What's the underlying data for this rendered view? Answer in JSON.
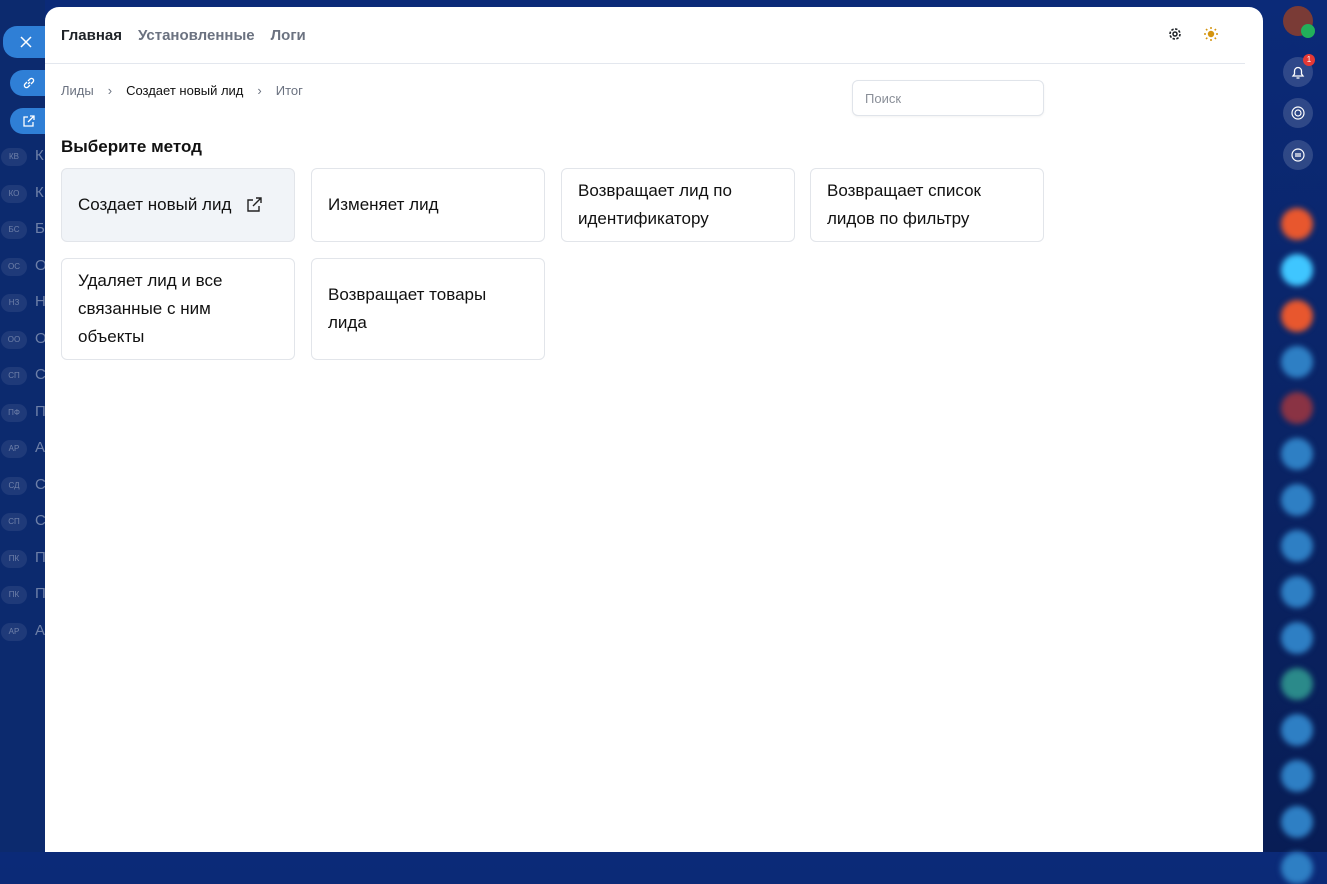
{
  "left_sidebar": {
    "abbreviations": [
      "КВ",
      "КО",
      "БС",
      "ОС",
      "НЗ",
      "ОО",
      "СП",
      "ПФ",
      "АР",
      "СД",
      "СП",
      "ПК",
      "ПК",
      "АР"
    ],
    "letters": [
      "К",
      "К",
      "Б",
      "О",
      "Н",
      "О",
      "С",
      "П",
      "А",
      "С",
      "С",
      "П",
      "П",
      "А"
    ]
  },
  "tabs": [
    {
      "label": "Главная",
      "active": true
    },
    {
      "label": "Установленные"
    },
    {
      "label": "Логи"
    }
  ],
  "breadcrumb": [
    "Лиды",
    "Создает новый лид",
    "Итог"
  ],
  "search": {
    "placeholder": "Поиск",
    "value": ""
  },
  "section_title": "Выберите метод",
  "methods": [
    {
      "label": "Создает новый лид",
      "selected": true
    },
    {
      "label": "Изменяет лид"
    },
    {
      "label": "Возвращает лид по идентификатору"
    },
    {
      "label": "Возвращает список лидов по фильтру"
    },
    {
      "label": "Удаляет лид и все связанные с ним объекты"
    },
    {
      "label": "Возвращает товары лида"
    }
  ],
  "right_bar": {
    "notification_count": "1"
  },
  "colors": {
    "accent": "#2f7fd6",
    "sun": "#d4940f"
  }
}
